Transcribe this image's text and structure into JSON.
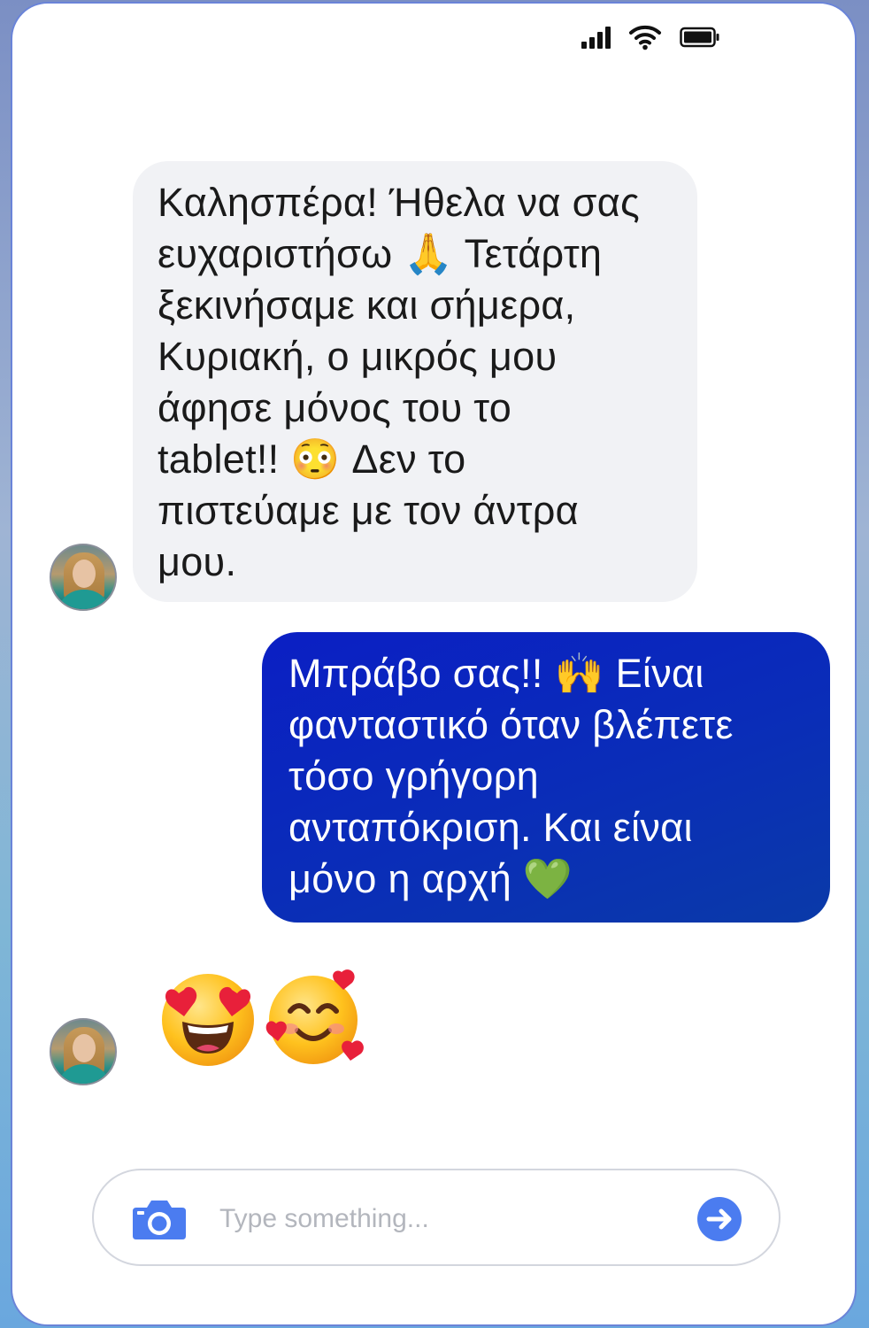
{
  "status_bar": {
    "icons": [
      "signal-icon",
      "wifi-icon",
      "battery-icon"
    ]
  },
  "messages": [
    {
      "direction": "incoming",
      "text": "Καλησπέρα! Ήθελα να σας\nευχαριστήσω 🙏 Τετάρτη\nξεκινήσαμε και σήμερα,\nΚυριακή, ο μικρός μου\nάφησε μόνος του το\ntablet!! 😳 Δεν το\nπιστεύαμε με τον άντρα\nμου."
    },
    {
      "direction": "outgoing",
      "text": "Μπράβο σας!! 🙌 Είναι\nφανταστικό όταν βλέπετε\nτόσο γρήγορη\nανταπόκριση. Και είναι\nμόνο η αρχή 💚"
    },
    {
      "direction": "incoming",
      "emojis": [
        "heart-eyes-emoji",
        "smiling-face-with-hearts-emoji"
      ]
    }
  ],
  "composer": {
    "placeholder": "Type something...",
    "value": ""
  },
  "colors": {
    "incoming_bubble": "#f1f2f5",
    "outgoing_bubble": "#0b1fc4",
    "accent": "#4b7cf0"
  }
}
